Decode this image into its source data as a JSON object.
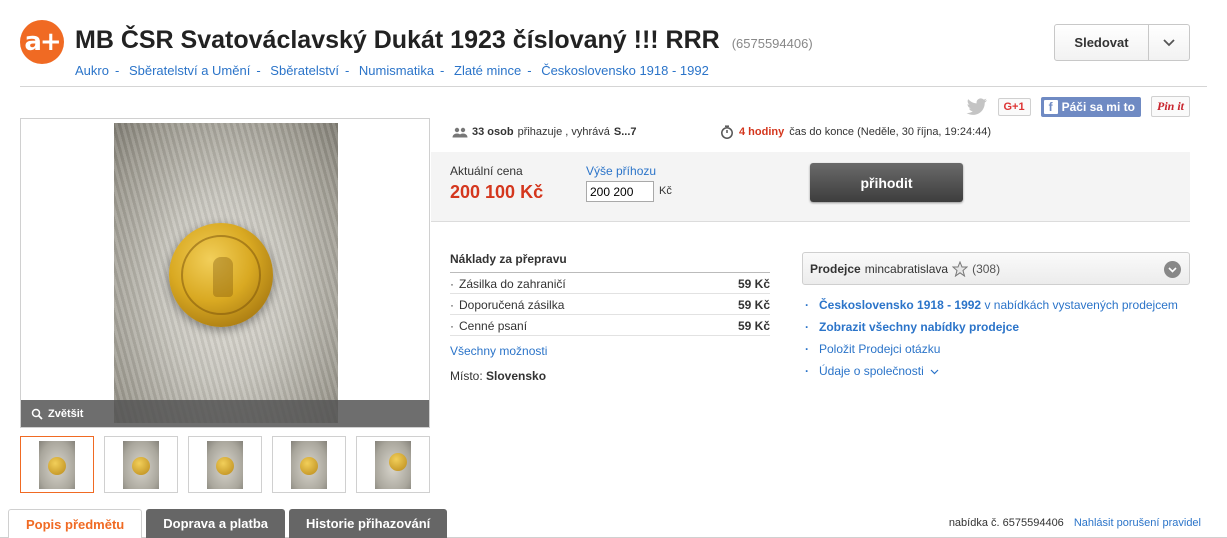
{
  "header": {
    "logo_text": "a+",
    "title": "MB ČSR Svatováclavský Dukát 1923 číslovaný !!! RRR",
    "item_id": "(6575594406)",
    "follow_label": "Sledovat"
  },
  "breadcrumb": [
    "Aukro",
    "Sběratelství a Umění",
    "Sběratelství",
    "Numismatika",
    "Zlaté mince",
    "Československo 1918 - 1992"
  ],
  "social": {
    "gplus": "G+1",
    "facebook": "Páči sa mi to",
    "pinterest": "Pin it"
  },
  "gallery": {
    "zoom_label": "Zvětšit",
    "thumb_count": 5
  },
  "auction": {
    "bidders_count": "33 osob",
    "bidders_text": "přihazuje , vyhrává",
    "leader": "S...7",
    "time_left": "4 hodiny",
    "time_text": "čas do konce (Neděle, 30 října, 19:24:44)",
    "current_price_label": "Aktuální cena",
    "current_price": "200 100 Kč",
    "increment_label": "Výše příhozu",
    "increment_value": "200 200",
    "increment_currency": "Kč",
    "bid_button": "přihodit"
  },
  "shipping": {
    "title": "Náklady za přepravu",
    "rows": [
      {
        "name": "Zásilka do zahraničí",
        "price": "59 Kč"
      },
      {
        "name": "Doporučená zásilka",
        "price": "59 Kč"
      },
      {
        "name": "Cenné psaní",
        "price": "59 Kč"
      }
    ],
    "more_link": "Všechny možnosti",
    "place_label": "Místo:",
    "place_value": "Slovensko"
  },
  "seller": {
    "label": "Prodejce",
    "name": "mincabratislava",
    "rating": "(308)",
    "links": [
      {
        "bold": "Československo 1918 - 1992",
        "rest": " v nabídkách vystavených prodejcem"
      },
      {
        "bold": "Zobrazit všechny nabídky prodejce",
        "rest": ""
      },
      {
        "bold": "",
        "rest": "Položit Prodejci otázku"
      },
      {
        "bold": "",
        "rest": "Údaje o společnosti"
      }
    ]
  },
  "tabs": [
    {
      "label": "Popis předmětu",
      "active": true
    },
    {
      "label": "Doprava a platba",
      "active": false
    },
    {
      "label": "Historie přihazování",
      "active": false
    }
  ],
  "footer": {
    "offer_number": "nabídka č. 6575594406",
    "report_link": "Nahlásit porušení pravidel"
  },
  "colors": {
    "brand": "#f06a23",
    "link": "#2b74c9",
    "price": "#d4361d"
  }
}
